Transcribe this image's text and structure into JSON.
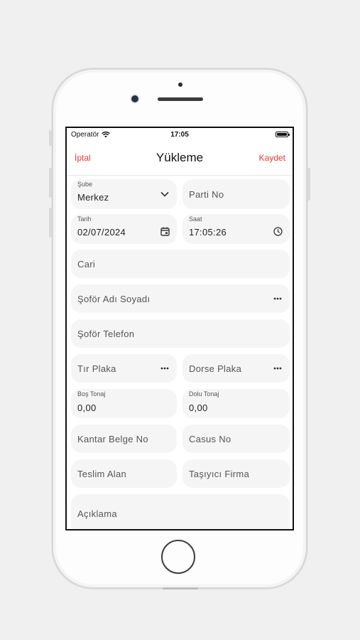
{
  "status": {
    "carrier": "Operatör",
    "time": "17:05"
  },
  "nav": {
    "cancel": "İptal",
    "title": "Yükleme",
    "save": "Kaydet"
  },
  "form": {
    "sube": {
      "label": "Şube",
      "value": "Merkez"
    },
    "parti_no": {
      "placeholder": "Parti No"
    },
    "tarih": {
      "label": "Tarih",
      "value": "02/07/2024"
    },
    "saat": {
      "label": "Saat",
      "value": "17:05:26"
    },
    "cari": {
      "placeholder": "Cari"
    },
    "sofor_adi": {
      "placeholder": "Şoför Adı Soyadı"
    },
    "sofor_telefon": {
      "placeholder": "Şoför Telefon"
    },
    "tir_plaka": {
      "placeholder": "Tır Plaka"
    },
    "dorse_plaka": {
      "placeholder": "Dorse Plaka"
    },
    "bos_tonaj": {
      "label": "Boş Tonaj",
      "value": "0,00"
    },
    "dolu_tonaj": {
      "label": "Dolu Tonaj",
      "value": "0,00"
    },
    "kantar_belge_no": {
      "placeholder": "Kantar Belge No"
    },
    "casus_no": {
      "placeholder": "Casus No"
    },
    "teslim_alan": {
      "placeholder": "Teslim Alan"
    },
    "tasiyici_firma": {
      "placeholder": "Taşıyıcı Firma"
    },
    "aciklama": {
      "placeholder": "Açıklama"
    }
  },
  "colors": {
    "accent": "#e53935",
    "field_bg": "#f5f5f6"
  }
}
